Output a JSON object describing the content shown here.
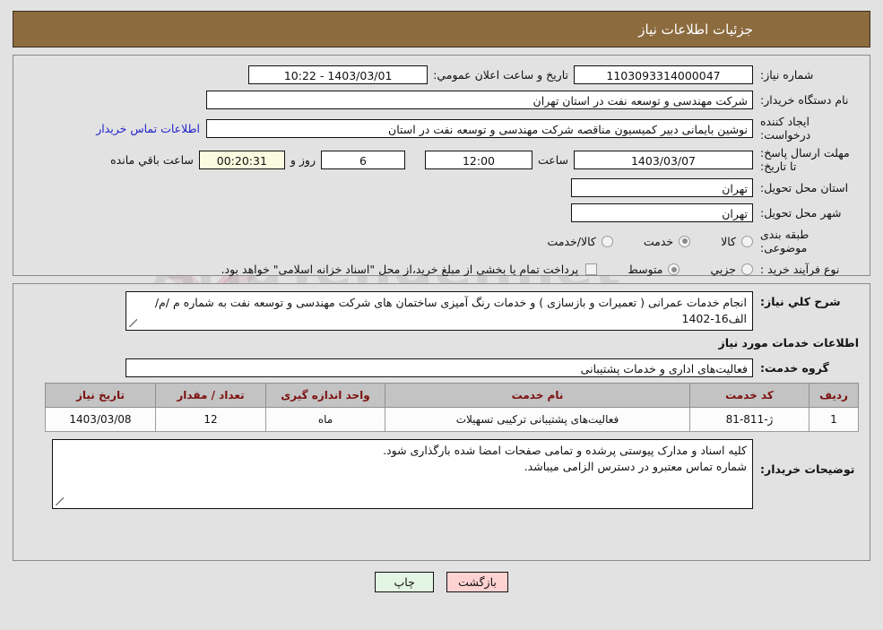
{
  "header": {
    "title": "جزئیات اطلاعات نیاز"
  },
  "summary": {
    "need_number_label": "شماره نیاز:",
    "need_number_value": "1103093314000047",
    "public_announce_label": "تاریخ و ساعت اعلان عمومي:",
    "public_announce_value": "1403/03/01 - 10:22",
    "buyer_org_label": "نام دستگاه خریدار:",
    "buyer_org_value": "شرکت مهندسی و توسعه نفت در استان تهران",
    "requester_label": "ایجاد کننده درخواست:",
    "requester_value": "نوشین بایمانی دبیر کمیسیون مناقصه شرکت مهندسی و توسعه نفت در استان",
    "contact_link": "اطلاعات تماس خریدار",
    "deadline_label": "مهلت ارسال پاسخ: تا تاریخ:",
    "deadline_date": "1403/03/07",
    "deadline_time_label": "ساعت",
    "deadline_time": "12:00",
    "remaining_days": "6",
    "remaining_days_label": "روز و",
    "remaining_clock": "00:20:31",
    "remaining_clock_label": "ساعت باقي مانده",
    "province_label": "استان محل تحویل:",
    "province_value": "تهران",
    "city_label": "شهر محل تحویل:",
    "city_value": "تهران",
    "category_label": "طبقه بندی موضوعی:",
    "category_options": [
      {
        "label": "کالا",
        "checked": false
      },
      {
        "label": "خدمت",
        "checked": true
      },
      {
        "label": "کالا/خدمت",
        "checked": false
      }
    ],
    "process_label": "نوع فرآیند خرید :",
    "process_options": [
      {
        "label": "جزیي",
        "checked": false
      },
      {
        "label": "متوسط",
        "checked": true
      }
    ],
    "treasury_checked": false,
    "treasury_note": "پرداخت تمام یا بخشی از مبلغ خرید،از محل \"اسناد خزانه اسلامی\" خواهد بود."
  },
  "need_description": {
    "label": "شرح کلي نیاز:",
    "value": "انجام خدمات عمرانی ( تعمیرات و بازسازی ) و خدمات رنگ آمیزی ساختمان های شرکت مهندسی و توسعه نفت به شماره م /م/الف16-1402"
  },
  "services_section": {
    "heading": "اطلاعات خدمات مورد نیاز",
    "service_group_label": "گروه خدمت:",
    "service_group_value": "فعالیت‌های اداری و خدمات پشتیبانی",
    "table": {
      "columns": [
        "ردیف",
        "کد خدمت",
        "نام خدمت",
        "واحد اندازه گیری",
        "تعداد / مقدار",
        "تاریخ نیاز"
      ],
      "rows": [
        [
          "1",
          "ژ-811-81",
          "فعالیت‌های پشتیبانی ترکیبی تسهیلات",
          "ماه",
          "12",
          "1403/03/08"
        ]
      ]
    }
  },
  "buyer_notes": {
    "label": "توضیحات خریدار:",
    "line1": "کلیه اسناد و مدارک پیوستی پرشده و تمامی صفحات امضا شده بارگذاری شود.",
    "line2": "شماره تماس معتبرو در دسترس الزامی میباشد."
  },
  "footer": {
    "back_button": "بازگشت",
    "print_button": "چاپ"
  },
  "watermark": {
    "text": "AriaTender.net"
  }
}
